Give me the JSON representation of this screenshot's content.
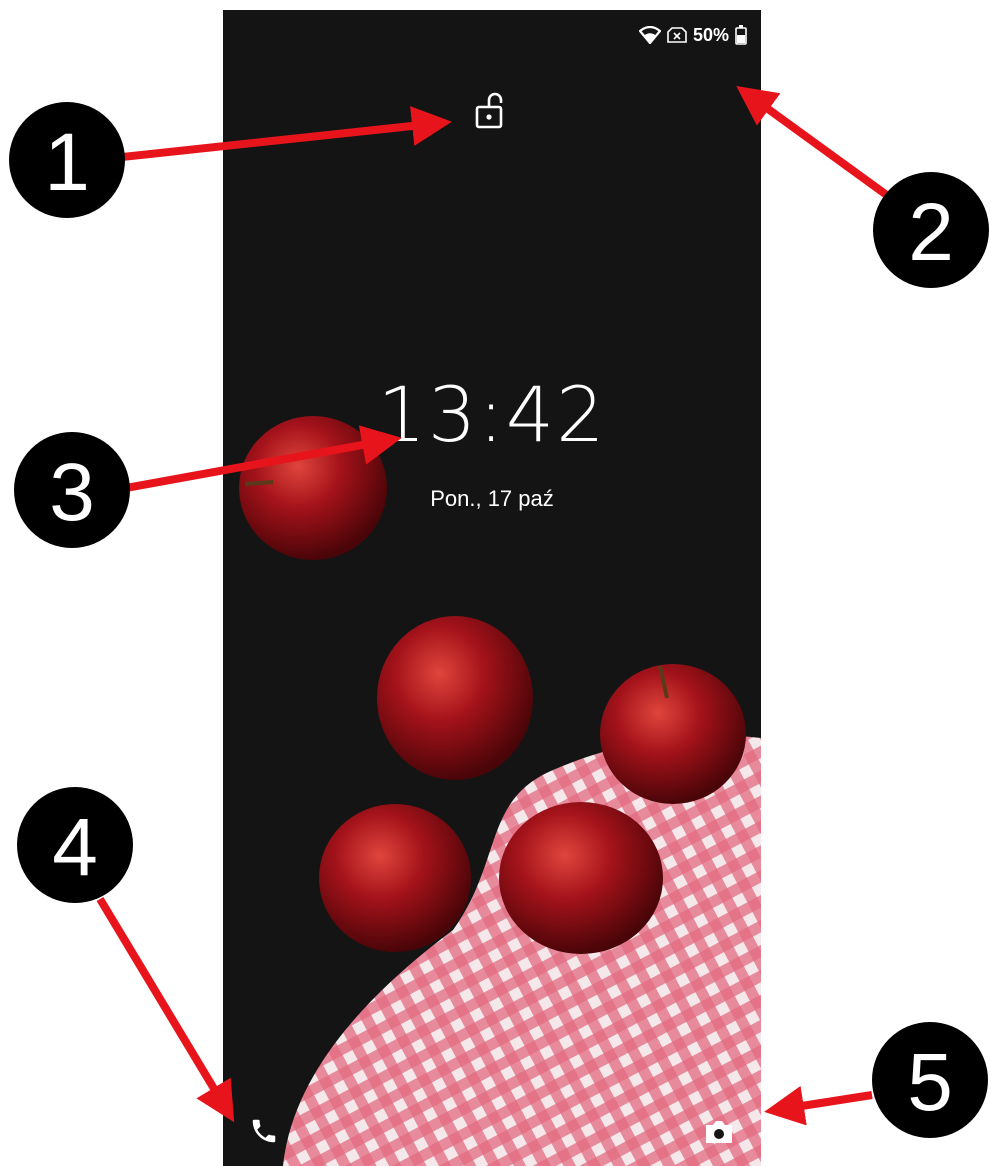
{
  "status_bar": {
    "battery_percent": "50%",
    "icons": [
      "wifi-icon",
      "no-sim-icon",
      "battery-icon"
    ]
  },
  "lock_screen": {
    "time": "13:42",
    "date": "Pon., 17 paź",
    "lock_icon": "unlocked-padlock-icon",
    "shortcuts": [
      "phone-icon",
      "camera-icon"
    ]
  },
  "annotations": {
    "numbers": [
      "1",
      "2",
      "3",
      "4",
      "5"
    ],
    "badge_color": "#000000",
    "arrow_color": "#e8141c"
  }
}
